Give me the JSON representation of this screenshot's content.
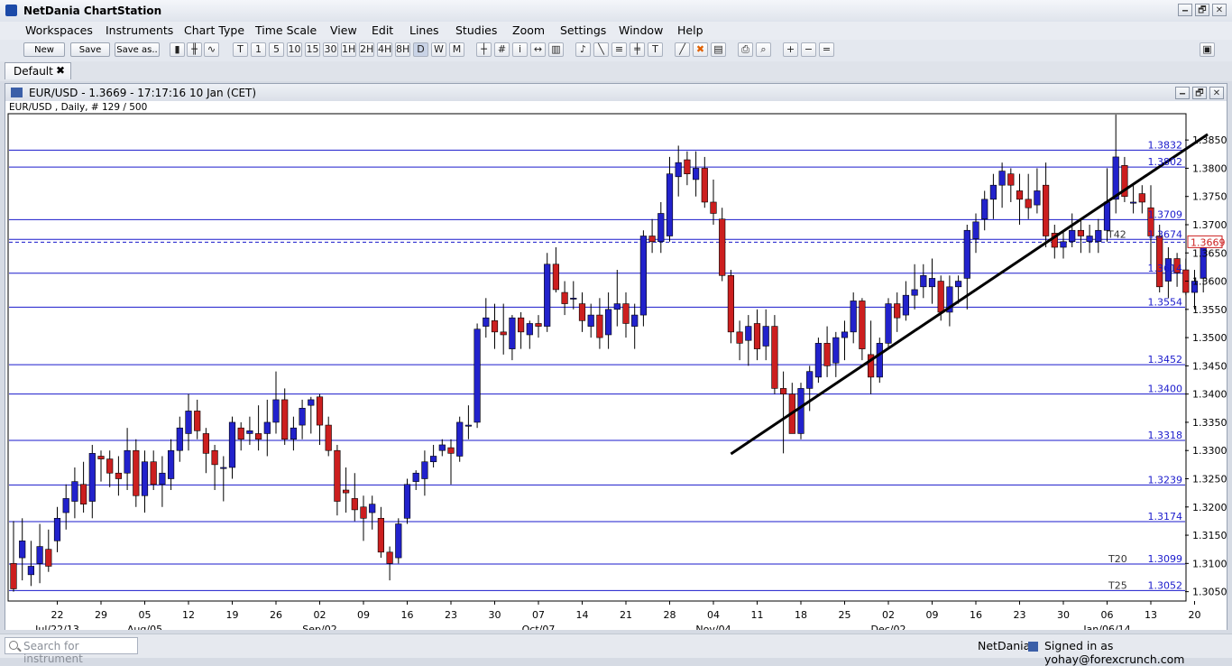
{
  "app": {
    "title": "NetDania ChartStation"
  },
  "window_buttons": [
    "🗕",
    "🗗",
    "✕"
  ],
  "menu": [
    "Workspaces",
    "Instruments",
    "Chart Type",
    "Time Scale",
    "View",
    "Edit",
    "Lines",
    "Studies",
    "Zoom",
    "Settings",
    "Window",
    "Help"
  ],
  "toolbar": {
    "new_label": "New",
    "save_label": "Save",
    "saveas_label": "Save as..",
    "timeframes": [
      "T",
      "1",
      "5",
      "10",
      "15",
      "30",
      "1H",
      "2H",
      "4H",
      "8H",
      "D",
      "W",
      "M"
    ]
  },
  "tab": {
    "label": "Default",
    "close": "✖"
  },
  "chart_window": {
    "title": "EUR/USD - 1.3669 - 17:17:16  10 Jan (CET)",
    "subtitle": "EUR/USD , Daily, # 129 / 500"
  },
  "status": {
    "search_placeholder": "Search for instrument",
    "brand": "NetDania",
    "signed_in": "Signed in as yohay@forexcrunch.com"
  },
  "colors": {
    "bull": "#2222cc",
    "bear": "#cc1f1f",
    "hline": "#1a1acc",
    "trend": "#000000"
  },
  "chart_data": {
    "type": "candlestick",
    "instrument": "EUR/USD",
    "timeframe": "Daily",
    "ylim": [
      1.3035,
      1.3895
    ],
    "yticks": [
      "1.3050",
      "1.3100",
      "1.3150",
      "1.3200",
      "1.3250",
      "1.3300",
      "1.3350",
      "1.3400",
      "1.3450",
      "1.3500",
      "1.3550",
      "1.3600",
      "1.3650",
      "1.3700",
      "1.3750",
      "1.3800",
      "1.3850"
    ],
    "current_price_label": "1.3669",
    "xticks": [
      {
        "i": 5,
        "day": "22",
        "month": "Jul/22/13"
      },
      {
        "i": 10,
        "day": "29"
      },
      {
        "i": 15,
        "day": "05",
        "month": "Aug/05"
      },
      {
        "i": 20,
        "day": "12"
      },
      {
        "i": 25,
        "day": "19"
      },
      {
        "i": 30,
        "day": "26"
      },
      {
        "i": 35,
        "day": "02",
        "month": "Sep/02"
      },
      {
        "i": 40,
        "day": "09"
      },
      {
        "i": 45,
        "day": "16"
      },
      {
        "i": 50,
        "day": "23"
      },
      {
        "i": 55,
        "day": "30"
      },
      {
        "i": 60,
        "day": "07",
        "month": "Oct/07"
      },
      {
        "i": 65,
        "day": "14"
      },
      {
        "i": 70,
        "day": "21"
      },
      {
        "i": 75,
        "day": "28"
      },
      {
        "i": 80,
        "day": "04",
        "month": "Nov/04"
      },
      {
        "i": 85,
        "day": "11"
      },
      {
        "i": 90,
        "day": "18"
      },
      {
        "i": 95,
        "day": "25"
      },
      {
        "i": 100,
        "day": "02",
        "month": "Dec/02"
      },
      {
        "i": 105,
        "day": "09"
      },
      {
        "i": 110,
        "day": "16"
      },
      {
        "i": 115,
        "day": "23"
      },
      {
        "i": 120,
        "day": "30"
      },
      {
        "i": 125,
        "day": "06",
        "month": "Jan/06/14"
      },
      {
        "i": 130,
        "day": "13"
      },
      {
        "i": 135,
        "day": "20"
      }
    ],
    "horizontal_lines": [
      {
        "value": 1.3832,
        "label": "1.3832"
      },
      {
        "value": 1.3802,
        "label": "1.3802"
      },
      {
        "value": 1.3709,
        "label": "1.3709"
      },
      {
        "value": 1.3674,
        "label": "1.3674",
        "tag": "T42"
      },
      {
        "value": 1.3614,
        "label": "1.3614"
      },
      {
        "value": 1.3554,
        "label": "1.3554"
      },
      {
        "value": 1.3452,
        "label": "1.3452"
      },
      {
        "value": 1.34,
        "label": "1.3400"
      },
      {
        "value": 1.3318,
        "label": "1.3318"
      },
      {
        "value": 1.3239,
        "label": "1.3239"
      },
      {
        "value": 1.3174,
        "label": "1.3174"
      },
      {
        "value": 1.3099,
        "label": "1.3099",
        "tag": "T20"
      },
      {
        "value": 1.3052,
        "label": "1.3052",
        "tag": "T25"
      }
    ],
    "trendline": {
      "from": {
        "i": 82,
        "value": 1.3294
      },
      "to": {
        "i": 136.5,
        "value": 1.386
      }
    },
    "candles": [
      [
        1.31,
        1.3175,
        1.305,
        1.3055
      ],
      [
        1.311,
        1.318,
        1.307,
        1.314
      ],
      [
        1.308,
        1.314,
        1.306,
        1.3095
      ],
      [
        1.31,
        1.317,
        1.3065,
        1.313
      ],
      [
        1.3125,
        1.316,
        1.3085,
        1.3095
      ],
      [
        1.314,
        1.32,
        1.312,
        1.318
      ],
      [
        1.319,
        1.324,
        1.316,
        1.3215
      ],
      [
        1.321,
        1.327,
        1.318,
        1.3245
      ],
      [
        1.324,
        1.328,
        1.319,
        1.3205
      ],
      [
        1.321,
        1.331,
        1.318,
        1.3295
      ],
      [
        1.329,
        1.33,
        1.3245,
        1.3285
      ],
      [
        1.3285,
        1.33,
        1.3235,
        1.326
      ],
      [
        1.326,
        1.329,
        1.322,
        1.325
      ],
      [
        1.326,
        1.334,
        1.323,
        1.33
      ],
      [
        1.33,
        1.332,
        1.32,
        1.322
      ],
      [
        1.322,
        1.33,
        1.319,
        1.328
      ],
      [
        1.328,
        1.33,
        1.323,
        1.324
      ],
      [
        1.324,
        1.329,
        1.32,
        1.326
      ],
      [
        1.325,
        1.332,
        1.323,
        1.33
      ],
      [
        1.33,
        1.336,
        1.328,
        1.334
      ],
      [
        1.333,
        1.34,
        1.33,
        1.337
      ],
      [
        1.337,
        1.339,
        1.332,
        1.3335
      ],
      [
        1.333,
        1.334,
        1.326,
        1.3295
      ],
      [
        1.33,
        1.331,
        1.323,
        1.3275
      ],
      [
        1.327,
        1.329,
        1.321,
        1.327
      ],
      [
        1.327,
        1.336,
        1.325,
        1.335
      ],
      [
        1.334,
        1.335,
        1.33,
        1.332
      ],
      [
        1.333,
        1.336,
        1.331,
        1.3335
      ],
      [
        1.333,
        1.338,
        1.33,
        1.332
      ],
      [
        1.333,
        1.339,
        1.329,
        1.335
      ],
      [
        1.335,
        1.344,
        1.333,
        1.339
      ],
      [
        1.339,
        1.341,
        1.331,
        1.332
      ],
      [
        1.332,
        1.336,
        1.33,
        1.334
      ],
      [
        1.3345,
        1.339,
        1.332,
        1.3375
      ],
      [
        1.338,
        1.3395,
        1.333,
        1.339
      ],
      [
        1.3395,
        1.34,
        1.331,
        1.3345
      ],
      [
        1.3345,
        1.336,
        1.329,
        1.33
      ],
      [
        1.33,
        1.331,
        1.3185,
        1.321
      ],
      [
        1.323,
        1.327,
        1.319,
        1.3225
      ],
      [
        1.3215,
        1.326,
        1.3175,
        1.3195
      ],
      [
        1.32,
        1.322,
        1.314,
        1.318
      ],
      [
        1.319,
        1.322,
        1.316,
        1.3205
      ],
      [
        1.318,
        1.32,
        1.311,
        1.312
      ],
      [
        1.312,
        1.313,
        1.307,
        1.31
      ],
      [
        1.311,
        1.318,
        1.31,
        1.317
      ],
      [
        1.318,
        1.325,
        1.317,
        1.324
      ],
      [
        1.3245,
        1.3265,
        1.323,
        1.326
      ],
      [
        1.325,
        1.33,
        1.322,
        1.328
      ],
      [
        1.328,
        1.331,
        1.327,
        1.329
      ],
      [
        1.33,
        1.332,
        1.329,
        1.331
      ],
      [
        1.3305,
        1.332,
        1.324,
        1.3295
      ],
      [
        1.329,
        1.336,
        1.328,
        1.335
      ],
      [
        1.3345,
        1.338,
        1.332,
        1.3345
      ],
      [
        1.335,
        1.3525,
        1.334,
        1.3515
      ],
      [
        1.352,
        1.357,
        1.35,
        1.3535
      ],
      [
        1.353,
        1.356,
        1.348,
        1.351
      ],
      [
        1.351,
        1.356,
        1.347,
        1.3505
      ],
      [
        1.348,
        1.354,
        1.346,
        1.3535
      ],
      [
        1.3535,
        1.3545,
        1.348,
        1.351
      ],
      [
        1.3505,
        1.353,
        1.348,
        1.3525
      ],
      [
        1.3525,
        1.354,
        1.35,
        1.352
      ],
      [
        1.352,
        1.365,
        1.351,
        1.363
      ],
      [
        1.363,
        1.366,
        1.358,
        1.3585
      ],
      [
        1.358,
        1.36,
        1.354,
        1.356
      ],
      [
        1.357,
        1.36,
        1.355,
        1.357
      ],
      [
        1.356,
        1.358,
        1.351,
        1.353
      ],
      [
        1.352,
        1.356,
        1.35,
        1.354
      ],
      [
        1.354,
        1.357,
        1.348,
        1.35
      ],
      [
        1.3505,
        1.358,
        1.348,
        1.355
      ],
      [
        1.355,
        1.362,
        1.352,
        1.356
      ],
      [
        1.356,
        1.358,
        1.35,
        1.3525
      ],
      [
        1.352,
        1.356,
        1.348,
        1.354
      ],
      [
        1.354,
        1.369,
        1.352,
        1.368
      ],
      [
        1.368,
        1.371,
        1.365,
        1.367
      ],
      [
        1.367,
        1.374,
        1.365,
        1.372
      ],
      [
        1.368,
        1.382,
        1.367,
        1.379
      ],
      [
        1.3785,
        1.384,
        1.375,
        1.381
      ],
      [
        1.3815,
        1.383,
        1.377,
        1.379
      ],
      [
        1.378,
        1.383,
        1.375,
        1.38
      ],
      [
        1.38,
        1.382,
        1.373,
        1.374
      ],
      [
        1.374,
        1.378,
        1.37,
        1.372
      ],
      [
        1.371,
        1.373,
        1.36,
        1.361
      ],
      [
        1.361,
        1.362,
        1.349,
        1.351
      ],
      [
        1.351,
        1.353,
        1.346,
        1.349
      ],
      [
        1.3495,
        1.354,
        1.345,
        1.352
      ],
      [
        1.3525,
        1.355,
        1.346,
        1.348
      ],
      [
        1.3485,
        1.355,
        1.346,
        1.352
      ],
      [
        1.352,
        1.354,
        1.34,
        1.341
      ],
      [
        1.341,
        1.344,
        1.3295,
        1.34
      ],
      [
        1.34,
        1.342,
        1.333,
        1.333
      ],
      [
        1.333,
        1.342,
        1.332,
        1.341
      ],
      [
        1.341,
        1.345,
        1.337,
        1.344
      ],
      [
        1.343,
        1.35,
        1.342,
        1.349
      ],
      [
        1.349,
        1.352,
        1.343,
        1.345
      ],
      [
        1.3455,
        1.351,
        1.343,
        1.35
      ],
      [
        1.35,
        1.353,
        1.346,
        1.351
      ],
      [
        1.351,
        1.358,
        1.349,
        1.3565
      ],
      [
        1.3565,
        1.357,
        1.346,
        1.348
      ],
      [
        1.347,
        1.353,
        1.34,
        1.343
      ],
      [
        1.343,
        1.35,
        1.342,
        1.349
      ],
      [
        1.349,
        1.357,
        1.348,
        1.356
      ],
      [
        1.356,
        1.358,
        1.351,
        1.3535
      ],
      [
        1.354,
        1.36,
        1.353,
        1.3575
      ],
      [
        1.3575,
        1.363,
        1.355,
        1.3585
      ],
      [
        1.359,
        1.363,
        1.357,
        1.361
      ],
      [
        1.359,
        1.364,
        1.356,
        1.3605
      ],
      [
        1.36,
        1.361,
        1.353,
        1.3545
      ],
      [
        1.3545,
        1.361,
        1.352,
        1.359
      ],
      [
        1.359,
        1.361,
        1.356,
        1.36
      ],
      [
        1.3605,
        1.37,
        1.355,
        1.369
      ],
      [
        1.3675,
        1.372,
        1.365,
        1.3705
      ],
      [
        1.371,
        1.376,
        1.369,
        1.3745
      ],
      [
        1.3745,
        1.379,
        1.371,
        1.377
      ],
      [
        1.377,
        1.381,
        1.373,
        1.3795
      ],
      [
        1.379,
        1.38,
        1.374,
        1.377
      ],
      [
        1.376,
        1.379,
        1.37,
        1.3745
      ],
      [
        1.3745,
        1.379,
        1.371,
        1.373
      ],
      [
        1.3735,
        1.38,
        1.372,
        1.376
      ],
      [
        1.377,
        1.381,
        1.366,
        1.368
      ],
      [
        1.3685,
        1.37,
        1.364,
        1.366
      ],
      [
        1.366,
        1.369,
        1.364,
        1.367
      ],
      [
        1.367,
        1.372,
        1.366,
        1.369
      ],
      [
        1.369,
        1.371,
        1.365,
        1.368
      ],
      [
        1.367,
        1.37,
        1.365,
        1.368
      ],
      [
        1.367,
        1.371,
        1.365,
        1.369
      ],
      [
        1.369,
        1.38,
        1.367,
        1.374
      ],
      [
        1.3745,
        1.3895,
        1.372,
        1.382
      ],
      [
        1.3805,
        1.382,
        1.374,
        1.375
      ],
      [
        1.374,
        1.377,
        1.372,
        1.374
      ],
      [
        1.3755,
        1.377,
        1.372,
        1.374
      ],
      [
        1.373,
        1.377,
        1.362,
        1.368
      ],
      [
        1.368,
        1.37,
        1.358,
        1.359
      ],
      [
        1.36,
        1.366,
        1.357,
        1.364
      ],
      [
        1.364,
        1.365,
        1.359,
        1.3615
      ],
      [
        1.362,
        1.364,
        1.3575,
        1.358
      ],
      [
        1.358,
        1.362,
        1.355,
        1.36
      ],
      [
        1.3605,
        1.368,
        1.358,
        1.3669
      ]
    ]
  }
}
